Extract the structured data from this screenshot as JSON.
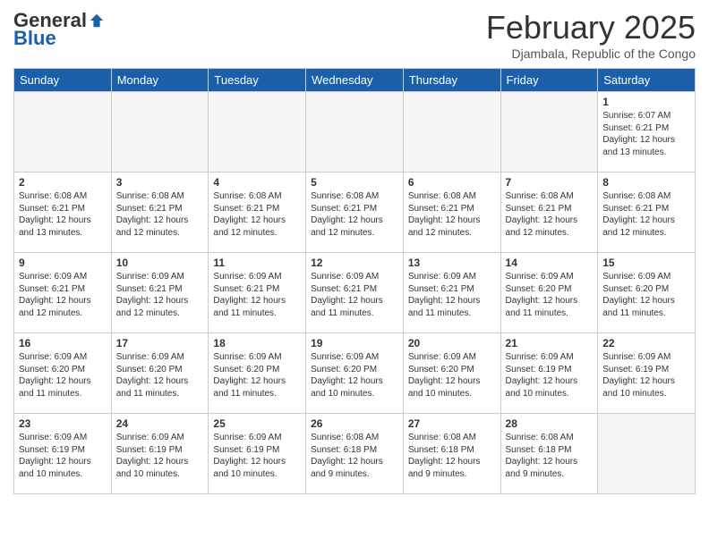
{
  "logo": {
    "general": "General",
    "blue": "Blue"
  },
  "title": {
    "month_year": "February 2025",
    "location": "Djambala, Republic of the Congo"
  },
  "headers": [
    "Sunday",
    "Monday",
    "Tuesday",
    "Wednesday",
    "Thursday",
    "Friday",
    "Saturday"
  ],
  "weeks": [
    [
      {
        "day": "",
        "info": ""
      },
      {
        "day": "",
        "info": ""
      },
      {
        "day": "",
        "info": ""
      },
      {
        "day": "",
        "info": ""
      },
      {
        "day": "",
        "info": ""
      },
      {
        "day": "",
        "info": ""
      },
      {
        "day": "1",
        "info": "Sunrise: 6:07 AM\nSunset: 6:21 PM\nDaylight: 12 hours\nand 13 minutes."
      }
    ],
    [
      {
        "day": "2",
        "info": "Sunrise: 6:08 AM\nSunset: 6:21 PM\nDaylight: 12 hours\nand 13 minutes."
      },
      {
        "day": "3",
        "info": "Sunrise: 6:08 AM\nSunset: 6:21 PM\nDaylight: 12 hours\nand 12 minutes."
      },
      {
        "day": "4",
        "info": "Sunrise: 6:08 AM\nSunset: 6:21 PM\nDaylight: 12 hours\nand 12 minutes."
      },
      {
        "day": "5",
        "info": "Sunrise: 6:08 AM\nSunset: 6:21 PM\nDaylight: 12 hours\nand 12 minutes."
      },
      {
        "day": "6",
        "info": "Sunrise: 6:08 AM\nSunset: 6:21 PM\nDaylight: 12 hours\nand 12 minutes."
      },
      {
        "day": "7",
        "info": "Sunrise: 6:08 AM\nSunset: 6:21 PM\nDaylight: 12 hours\nand 12 minutes."
      },
      {
        "day": "8",
        "info": "Sunrise: 6:08 AM\nSunset: 6:21 PM\nDaylight: 12 hours\nand 12 minutes."
      }
    ],
    [
      {
        "day": "9",
        "info": "Sunrise: 6:09 AM\nSunset: 6:21 PM\nDaylight: 12 hours\nand 12 minutes."
      },
      {
        "day": "10",
        "info": "Sunrise: 6:09 AM\nSunset: 6:21 PM\nDaylight: 12 hours\nand 12 minutes."
      },
      {
        "day": "11",
        "info": "Sunrise: 6:09 AM\nSunset: 6:21 PM\nDaylight: 12 hours\nand 11 minutes."
      },
      {
        "day": "12",
        "info": "Sunrise: 6:09 AM\nSunset: 6:21 PM\nDaylight: 12 hours\nand 11 minutes."
      },
      {
        "day": "13",
        "info": "Sunrise: 6:09 AM\nSunset: 6:21 PM\nDaylight: 12 hours\nand 11 minutes."
      },
      {
        "day": "14",
        "info": "Sunrise: 6:09 AM\nSunset: 6:20 PM\nDaylight: 12 hours\nand 11 minutes."
      },
      {
        "day": "15",
        "info": "Sunrise: 6:09 AM\nSunset: 6:20 PM\nDaylight: 12 hours\nand 11 minutes."
      }
    ],
    [
      {
        "day": "16",
        "info": "Sunrise: 6:09 AM\nSunset: 6:20 PM\nDaylight: 12 hours\nand 11 minutes."
      },
      {
        "day": "17",
        "info": "Sunrise: 6:09 AM\nSunset: 6:20 PM\nDaylight: 12 hours\nand 11 minutes."
      },
      {
        "day": "18",
        "info": "Sunrise: 6:09 AM\nSunset: 6:20 PM\nDaylight: 12 hours\nand 11 minutes."
      },
      {
        "day": "19",
        "info": "Sunrise: 6:09 AM\nSunset: 6:20 PM\nDaylight: 12 hours\nand 10 minutes."
      },
      {
        "day": "20",
        "info": "Sunrise: 6:09 AM\nSunset: 6:20 PM\nDaylight: 12 hours\nand 10 minutes."
      },
      {
        "day": "21",
        "info": "Sunrise: 6:09 AM\nSunset: 6:19 PM\nDaylight: 12 hours\nand 10 minutes."
      },
      {
        "day": "22",
        "info": "Sunrise: 6:09 AM\nSunset: 6:19 PM\nDaylight: 12 hours\nand 10 minutes."
      }
    ],
    [
      {
        "day": "23",
        "info": "Sunrise: 6:09 AM\nSunset: 6:19 PM\nDaylight: 12 hours\nand 10 minutes."
      },
      {
        "day": "24",
        "info": "Sunrise: 6:09 AM\nSunset: 6:19 PM\nDaylight: 12 hours\nand 10 minutes."
      },
      {
        "day": "25",
        "info": "Sunrise: 6:09 AM\nSunset: 6:19 PM\nDaylight: 12 hours\nand 10 minutes."
      },
      {
        "day": "26",
        "info": "Sunrise: 6:08 AM\nSunset: 6:18 PM\nDaylight: 12 hours\nand 9 minutes."
      },
      {
        "day": "27",
        "info": "Sunrise: 6:08 AM\nSunset: 6:18 PM\nDaylight: 12 hours\nand 9 minutes."
      },
      {
        "day": "28",
        "info": "Sunrise: 6:08 AM\nSunset: 6:18 PM\nDaylight: 12 hours\nand 9 minutes."
      },
      {
        "day": "",
        "info": ""
      }
    ]
  ]
}
